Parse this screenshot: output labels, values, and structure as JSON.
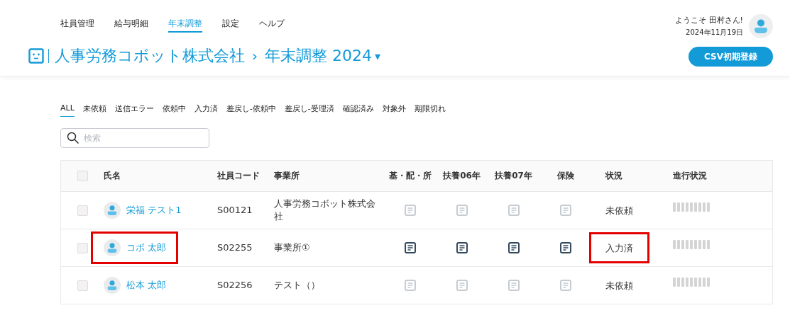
{
  "nav": [
    {
      "label": "社員管理",
      "selected": false
    },
    {
      "label": "給与明細",
      "selected": false
    },
    {
      "label": "年末調整",
      "selected": true
    },
    {
      "label": "設定",
      "selected": false
    },
    {
      "label": "ヘルプ",
      "selected": false
    }
  ],
  "breadcrumb": {
    "company": "人事労務コボット株式会社",
    "separator": "›",
    "page": "年末調整 2024",
    "caret": "▾"
  },
  "user": {
    "welcome": "ようこそ 田村さん!",
    "date": "2024年11月19日"
  },
  "csv_button": "CSV初期登録",
  "filters": [
    {
      "label": "ALL",
      "selected": true
    },
    {
      "label": "未依頼",
      "selected": false
    },
    {
      "label": "送信エラー",
      "selected": false
    },
    {
      "label": "依頼中",
      "selected": false
    },
    {
      "label": "入力済",
      "selected": false
    },
    {
      "label": "差戻し-依頼中",
      "selected": false
    },
    {
      "label": "差戻し-受理済",
      "selected": false
    },
    {
      "label": "確認済み",
      "selected": false
    },
    {
      "label": "対象外",
      "selected": false
    },
    {
      "label": "期限切れ",
      "selected": false
    }
  ],
  "search": {
    "placeholder": "検索"
  },
  "table": {
    "columns": [
      "氏名",
      "社員コード",
      "事業所",
      "基・配・所",
      "扶養06年",
      "扶養07年",
      "保険",
      "状況",
      "進行状況"
    ],
    "select_all": {
      "checked": false
    },
    "rows": [
      {
        "checked": false,
        "name": "栄福 テスト1",
        "code": "S00121",
        "office": "人事労務コボット株式会社",
        "docs": [
          false,
          false,
          false,
          false
        ],
        "status": "未依頼",
        "name_highlighted": false,
        "status_highlighted": false
      },
      {
        "checked": false,
        "name": "コボ 太郎",
        "code": "S02255",
        "office": "事業所①",
        "docs": [
          true,
          true,
          true,
          true
        ],
        "status": "入力済",
        "name_highlighted": true,
        "status_highlighted": true
      },
      {
        "checked": false,
        "name": "松本 太郎",
        "code": "S02256",
        "office": "テスト（）",
        "docs": [
          false,
          false,
          false,
          false
        ],
        "status": "未依頼",
        "name_highlighted": false,
        "status_highlighted": false
      }
    ]
  }
}
